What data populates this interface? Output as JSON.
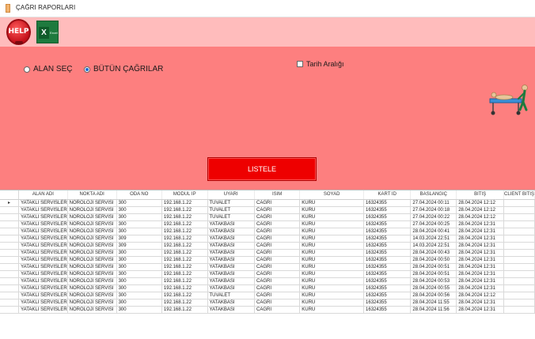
{
  "window": {
    "title": "ÇAĞRI RAPORLARI"
  },
  "toolbar": {
    "help_label": "HELP",
    "excel_label": "Excel"
  },
  "filters": {
    "radio_area": "ALAN SEÇ",
    "radio_all": "BÜTÜN ÇAĞRILAR",
    "radio_selected": "all",
    "date_range_label": "Tarih Aralığı",
    "date_range_checked": false,
    "list_button": "LISTELE"
  },
  "grid": {
    "columns": [
      "ALAN ADI",
      "NOKTA ADI",
      "ODA NO",
      "MODUL IP",
      "UYARI",
      "ISIM",
      "SOYAD",
      "KART ID",
      "BASLANGIÇ",
      "BITIŞ",
      "CLIENT BITIŞ"
    ],
    "current_row_marker": "▸",
    "rows": [
      [
        "YATAKLI SERVISLER",
        "NOROLOJI SERVISI",
        "300",
        "192.168.1.22",
        "TUVALET",
        "CAGRI",
        "KURU",
        "16324355",
        "27.04.2024 00:11",
        "28.04.2024 12:12",
        ""
      ],
      [
        "YATAKLI SERVISLER",
        "NOROLOJI SERVISI",
        "300",
        "192.168.1.22",
        "TUVALET",
        "CAGRI",
        "KURU",
        "16324355",
        "27.04.2024 00:18",
        "28.04.2024 12:12",
        ""
      ],
      [
        "YATAKLI SERVISLER",
        "NOROLOJI SERVISI",
        "300",
        "192.168.1.22",
        "TUVALET",
        "CAGRI",
        "KURU",
        "16324355",
        "27.04.2024 00:22",
        "28.04.2024 12:12",
        ""
      ],
      [
        "YATAKLI SERVISLER",
        "NOROLOJI SERVISI",
        "300",
        "192.168.1.22",
        "YATAKBASI",
        "CAGRI",
        "KURU",
        "16324355",
        "27.04.2024 00:25",
        "28.04.2024 12:31",
        ""
      ],
      [
        "YATAKLI SERVISLER",
        "NOROLOJI SERVISI",
        "300",
        "192.168.1.22",
        "YATAKBASI",
        "CAGRI",
        "KURU",
        "16324355",
        "28.04.2024 00:41",
        "28.04.2024 12:31",
        ""
      ],
      [
        "YATAKLI SERVISLER",
        "NOROLOJI SERVISI",
        "309",
        "192.168.1.22",
        "YATAKBASI",
        "CAGRI",
        "KURU",
        "16324355",
        "14.03.2024 22:51",
        "28.04.2024 12:31",
        ""
      ],
      [
        "YATAKLI SERVISLER",
        "NOROLOJI SERVISI",
        "309",
        "192.168.1.22",
        "YATAKBASI",
        "CAGRI",
        "KURU",
        "16324355",
        "14.03.2024 22:51",
        "28.04.2024 12:31",
        ""
      ],
      [
        "YATAKLI SERVISLER",
        "NOROLOJI SERVISI",
        "300",
        "192.168.1.22",
        "YATAKBASI",
        "CAGRI",
        "KURU",
        "16324355",
        "28.04.2024 00:43",
        "28.04.2024 12:31",
        ""
      ],
      [
        "YATAKLI SERVISLER",
        "NOROLOJI SERVISI",
        "300",
        "192.168.1.22",
        "YATAKBASI",
        "CAGRI",
        "KURU",
        "16324355",
        "28.04.2024 00:50",
        "28.04.2024 12:31",
        ""
      ],
      [
        "YATAKLI SERVISLER",
        "NOROLOJI SERVISI",
        "300",
        "192.168.1.22",
        "YATAKBASI",
        "CAGRI",
        "KURU",
        "16324355",
        "28.04.2024 00:51",
        "28.04.2024 12:31",
        ""
      ],
      [
        "YATAKLI SERVISLER",
        "NOROLOJI SERVISI",
        "300",
        "192.168.1.22",
        "YATAKBASI",
        "CAGRI",
        "KURU",
        "16324355",
        "28.04.2024 00:51",
        "28.04.2024 12:31",
        ""
      ],
      [
        "YATAKLI SERVISLER",
        "NOROLOJI SERVISI",
        "300",
        "192.168.1.22",
        "YATAKBASI",
        "CAGRI",
        "KURU",
        "16324355",
        "28.04.2024 00:53",
        "28.04.2024 12:31",
        ""
      ],
      [
        "YATAKLI SERVISLER",
        "NOROLOJI SERVISI",
        "300",
        "192.168.1.22",
        "YATAKBASI",
        "CAGRI",
        "KURU",
        "16324355",
        "28.04.2024 00:55",
        "28.04.2024 12:31",
        ""
      ],
      [
        "YATAKLI SERVISLER",
        "NOROLOJI SERVISI",
        "300",
        "192.168.1.22",
        "TUVALET",
        "CAGRI",
        "KURU",
        "16324355",
        "28.04.2024 00:56",
        "28.04.2024 12:12",
        ""
      ],
      [
        "YATAKLI SERVISLER",
        "NOROLOJI SERVISI",
        "300",
        "192.168.1.22",
        "YATAKBASI",
        "CAGRI",
        "KURU",
        "16324355",
        "28.04.2024 11:55",
        "28.04.2024 12:31",
        ""
      ],
      [
        "YATAKLI SERVISLER",
        "NOROLOJI SERVISI",
        "300",
        "192.168.1.22",
        "YATAKBASI",
        "CAGRI",
        "KURU",
        "16324355",
        "28.04.2024 11:56",
        "28.04.2024 12:31",
        ""
      ]
    ]
  },
  "colors": {
    "toolbar_bg": "#ffbcbc",
    "panel_bg": "#fd7f7f",
    "list_button_bg": "#ee0000",
    "radio_selected": "#1b6bd6"
  },
  "icons": {
    "help": "help-lifebuoy-icon",
    "excel": "excel-icon",
    "figure": "patient-stretcher-icon"
  }
}
